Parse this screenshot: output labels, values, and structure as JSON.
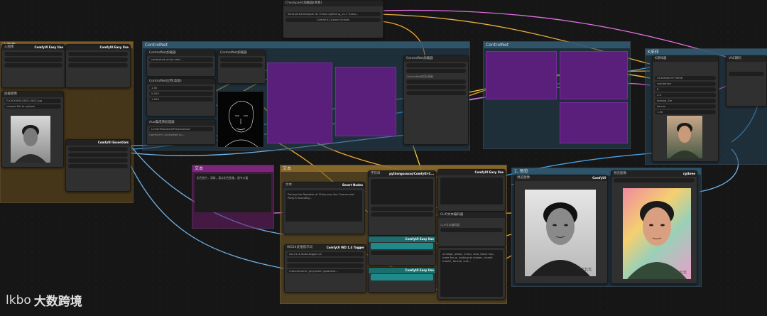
{
  "groups": {
    "left": {
      "title": "入图像"
    },
    "controlnet": {
      "title": "ControlNet"
    },
    "controlnet2": {
      "title": "ControlNet"
    },
    "sampler": {
      "title": "K采样"
    },
    "text": {
      "title": "文本"
    },
    "preview": {
      "title": "1. 预览"
    }
  },
  "nodes": {
    "easyuse_a": {
      "title": "入图像",
      "badge": "ComfyUI Easy Use"
    },
    "easyuse_b": {
      "badge": "ComfyUI Easy Use"
    },
    "loadimage": {
      "title": "加载图像",
      "file": "FLUX-YXHD-0002-0001.jpg",
      "button": "choose file to upload"
    },
    "essentials": {
      "badge": "ComfyUI Essentials"
    },
    "checkpoint": {
      "title": "Checkpoint加载器(简易)",
      "model": "SDXL\\DreamShaper XL Turbo Lightning_v2.1 Turbo...",
      "badge": "ComfyUI-Custom-Scripts"
    },
    "cn_loader_a": {
      "title": "ControlNet加载器",
      "value": "controlnet-union-sdxl..."
    },
    "cn_loader_b": {
      "title": "ControlNet加载器"
    },
    "cn_apply": {
      "title": "ControlNet应用(高级)",
      "strength": "1.00",
      "start": "0.000",
      "end": "1.000"
    },
    "aux": {
      "title": "Aux集成预处理器",
      "value": "LineartStandardPreprocessor",
      "badge": "ComfyUI's ControlNet Au..."
    },
    "cn_loader_c": {
      "title": "ControlNet加载器"
    },
    "cn_apply_b": {
      "title": "ControlNet应用(高级)"
    },
    "magenta_note": {
      "title": "文本",
      "text": "彩色照片，清晰，真实彩色图像，细节丰富"
    },
    "text_node": {
      "title": "文本",
      "text": "During the Republic of China era, the Communist Party's founding..."
    },
    "smart_nodes": {
      "badge": "Smart Nodes"
    },
    "pysssss": {
      "title": "字符串",
      "badge": "pythongosssss/ComfyUI-C..."
    },
    "easyuse_c": {
      "badge": "ComfyUI Easy Use"
    },
    "easyuse_d": {
      "badge": "ComfyUI Easy Use"
    },
    "easyuse_e": {
      "badge": "ComfyUI Easy Use"
    },
    "wd14": {
      "title": "WD14反推提示词",
      "model": "wd-v1-4-moat-tagger-v2",
      "badge": "ComfyUI WD 1.4 Tagger",
      "tags": "monochrome, greyscale, japanese..."
    },
    "clip_a": {
      "title": "CLIP文本编码器"
    },
    "clip_b": {
      "title": "CLIP文本编码器"
    },
    "longtext": {
      "text": "vintage, photo, 1man, solo, black hair, male focus, looking at viewer, closed mouth, formal, suit..."
    },
    "ksampler": {
      "title": "K采样器",
      "seed": "551690833775098",
      "control": "randomize",
      "steps": "8",
      "cfg": "2.0",
      "sampler": "dpmpp_2m",
      "scheduler": "karras",
      "denoise": "1.00"
    },
    "vae": {
      "title": "VAE解码"
    },
    "preview_a": {
      "title": "预览图像"
    },
    "preview_b": {
      "title": "预览图像",
      "badge": "rgthree"
    },
    "comfyui_label": {
      "badge": "ComfyUI"
    }
  },
  "photos": {
    "small_caption": "宁北北北"
  },
  "watermark": {
    "logo": "lkbo",
    "text": "大数跨境"
  }
}
